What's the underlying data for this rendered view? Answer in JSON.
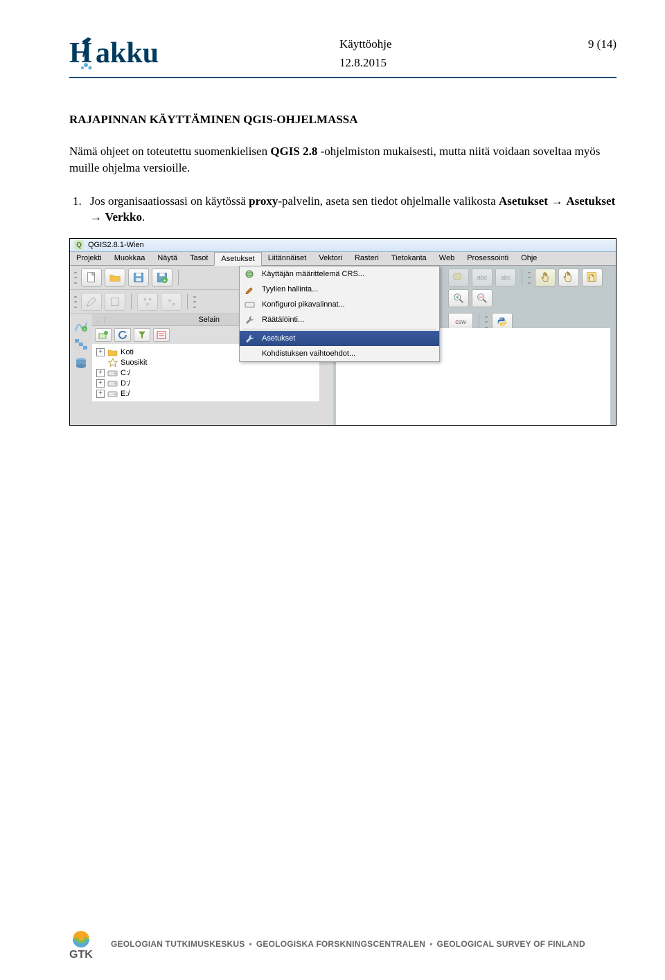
{
  "header": {
    "title": "Käyttöohje",
    "page": "9 (14)",
    "date": "12.8.2015",
    "logo_text": "akku"
  },
  "heading": "RAJAPINNAN KÄYTTÄMINEN QGIS-OHJELMASSA",
  "intro_p1": "Nämä ohjeet on toteutettu suomenkielisen ",
  "intro_bold": "QGIS 2.8",
  "intro_p2": " -ohjelmiston mukaisesti, mutta niitä voidaan soveltaa myös muille ohjelma versioille.",
  "step_prefix": "Jos organisaatiossasi on käytössä ",
  "step_bold1": "proxy",
  "step_mid": "-palvelin, aseta sen tiedot ohjelmalle valikosta ",
  "step_path1": "Asetukset",
  "step_arrow": " → ",
  "step_path2": "Asetukset",
  "step_path3": "Verkko",
  "step_end": ".",
  "screenshot": {
    "title": "QGIS2.8.1-Wien",
    "menus": [
      "Projekti",
      "Muokkaa",
      "Näytä",
      "Tasot",
      "Asetukset",
      "Liitännäiset",
      "Vektori",
      "Rasteri",
      "Tietokanta",
      "Web",
      "Prosessointi",
      "Ohje"
    ],
    "dropdown": [
      "Käyttäjän määrittelemä CRS...",
      "Tyylien hallinta...",
      "Konfiguroi pikavalinnat...",
      "Räätälöinti...",
      "Asetukset",
      "Kohdistuksen vaihtoehdot..."
    ],
    "browser_label": "Selain",
    "tree": [
      {
        "exp": "+",
        "icon": "home",
        "label": "Koti"
      },
      {
        "exp": "",
        "icon": "star",
        "label": "Suosikit"
      },
      {
        "exp": "+",
        "icon": "drive",
        "label": "C:/"
      },
      {
        "exp": "+",
        "icon": "drive",
        "label": "D:/"
      },
      {
        "exp": "+",
        "icon": "drive",
        "label": "E:/"
      }
    ],
    "abc": "abc",
    "csw": "sw"
  },
  "footer": {
    "logo": "GTK",
    "t1": "GEOLOGIAN TUTKIMUSKESKUS",
    "t2": "GEOLOGISKA FORSKNINGSCENTRALEN",
    "t3": "GEOLOGICAL SURVEY OF FINLAND"
  }
}
